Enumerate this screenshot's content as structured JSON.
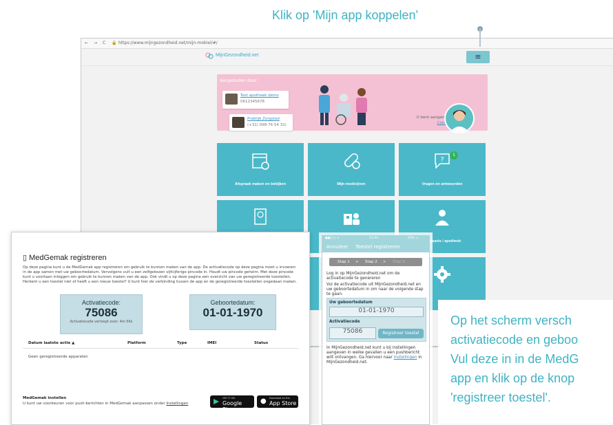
{
  "callouts": {
    "top": "Klik op 'Mijn app koppelen'",
    "right_lines": [
      "Op het scherm versch",
      "activatiecode en geboo",
      "Vul deze in in de MedG",
      "app en klik op de knop",
      "'registreer toestel'."
    ]
  },
  "browser": {
    "url": "https://www.mijngezondheid.net/mijn-mobiel/#/",
    "nav_glyphs": [
      "←",
      "→",
      "C"
    ],
    "logo": "MijnGezondheid.net",
    "menu_icon": "≡"
  },
  "banner": {
    "label": "Aangeboden door:",
    "pharmacy": {
      "name": "Test apotheek demo",
      "phone": "0612345678"
    },
    "practice": {
      "name": "Praktijk Zorgstad",
      "phone": "(+31) 098-76 54 32)"
    },
    "logged_in_label": "U bent aangemeld als:",
    "user": "Connie Buis"
  },
  "tiles": [
    {
      "label": "Afspraak maken en bekijken",
      "icon": "calendar-icon"
    },
    {
      "label": "Mijn medicijnen",
      "icon": "pill-icon"
    },
    {
      "label": "Vragen en antwoorden",
      "icon": "chat-question-icon",
      "badge": "1"
    },
    {
      "label": "",
      "icon": "document-icon"
    },
    {
      "label": "",
      "icon": "clinic-icon"
    },
    {
      "label": "s huisarts / apotheek",
      "icon": "doctor-icon"
    },
    {
      "label": "",
      "icon": "gear-icon"
    }
  ],
  "phone": {
    "status_left": "●●○○ ≈",
    "status_mid": "13:43",
    "status_right": "60% ▭",
    "cancel": "Annuleer",
    "title": "Toestel registreren",
    "steps": [
      "Stap 1",
      ">",
      "Stap 2",
      ">",
      "Stap 3"
    ],
    "intro1": "Log in op MijnGezondheid.net om de activatiecode te genereren",
    "intro2": "Vul de activatiecode uit MijnGezondheid.net en uw geboortedatum in om naar de volgende stap te gaan.",
    "dob_label": "Uw geboortedatum",
    "dob_value": "01-01-1970",
    "code_label": "Activatiecode",
    "code_value": "75086",
    "register_button": "Registreer toestel",
    "outro_pre": "In MijnGezondheid.net kunt u bij instellingen aangeven in welke gevallen u een pushbericht wilt ontvangen. Ga hiervoor naar ",
    "outro_link": "Instellingen",
    "outro_post": " in MijnGezondheid.net."
  },
  "page": {
    "title": "MedGemak registreren",
    "intro": "Op deze pagina kunt u de MedGemak app registreren om gebruik te kunnen maken van de app. De activatiecode op deze pagina moet u invoeren in de app samen met uw geboortedatum. Vervolgens vult u een zelfgekozen vijfcijferige pincode in. Houdt uw pincode geheim. Met deze pincode kunt u voortaan inloggen om gebruik te kunnen maken van de app. Ook vindt u op deze pagina een overzicht van uw geregistreerde toestellen. Herkent u een toestel niet of heeft u een nieuw toestel? U kunt hier de verbinding tussen de app en de geregistreerde toestellen ongedaan maken.",
    "activation": {
      "label": "Activatiecode:",
      "value": "75086",
      "expires": "Activatiecode verloopt over: 4m 56s"
    },
    "birthdate": {
      "label": "Geboortedatum:",
      "value": "01-01-1970"
    },
    "table_headers": [
      "Datum laatste actie ▲",
      "Platform",
      "Type",
      "IMEI",
      "Status"
    ],
    "empty_row": "Geen geregistreerde apparaten",
    "settings_title": "MedGemak instellen",
    "settings_text_pre": "U kunt uw voorkeuren voor push-berichten in MedGemak aanpassen onder ",
    "settings_link": "Instellingen",
    "google": {
      "small": "GET IT ON",
      "big": "Google Play"
    },
    "apple": {
      "small": "Download on the",
      "big": "App Store"
    }
  },
  "colors": {
    "accent": "#3fb3c3",
    "tile": "#4ab8c8",
    "banner": "#f3c1d3",
    "badge": "#35b25a"
  }
}
